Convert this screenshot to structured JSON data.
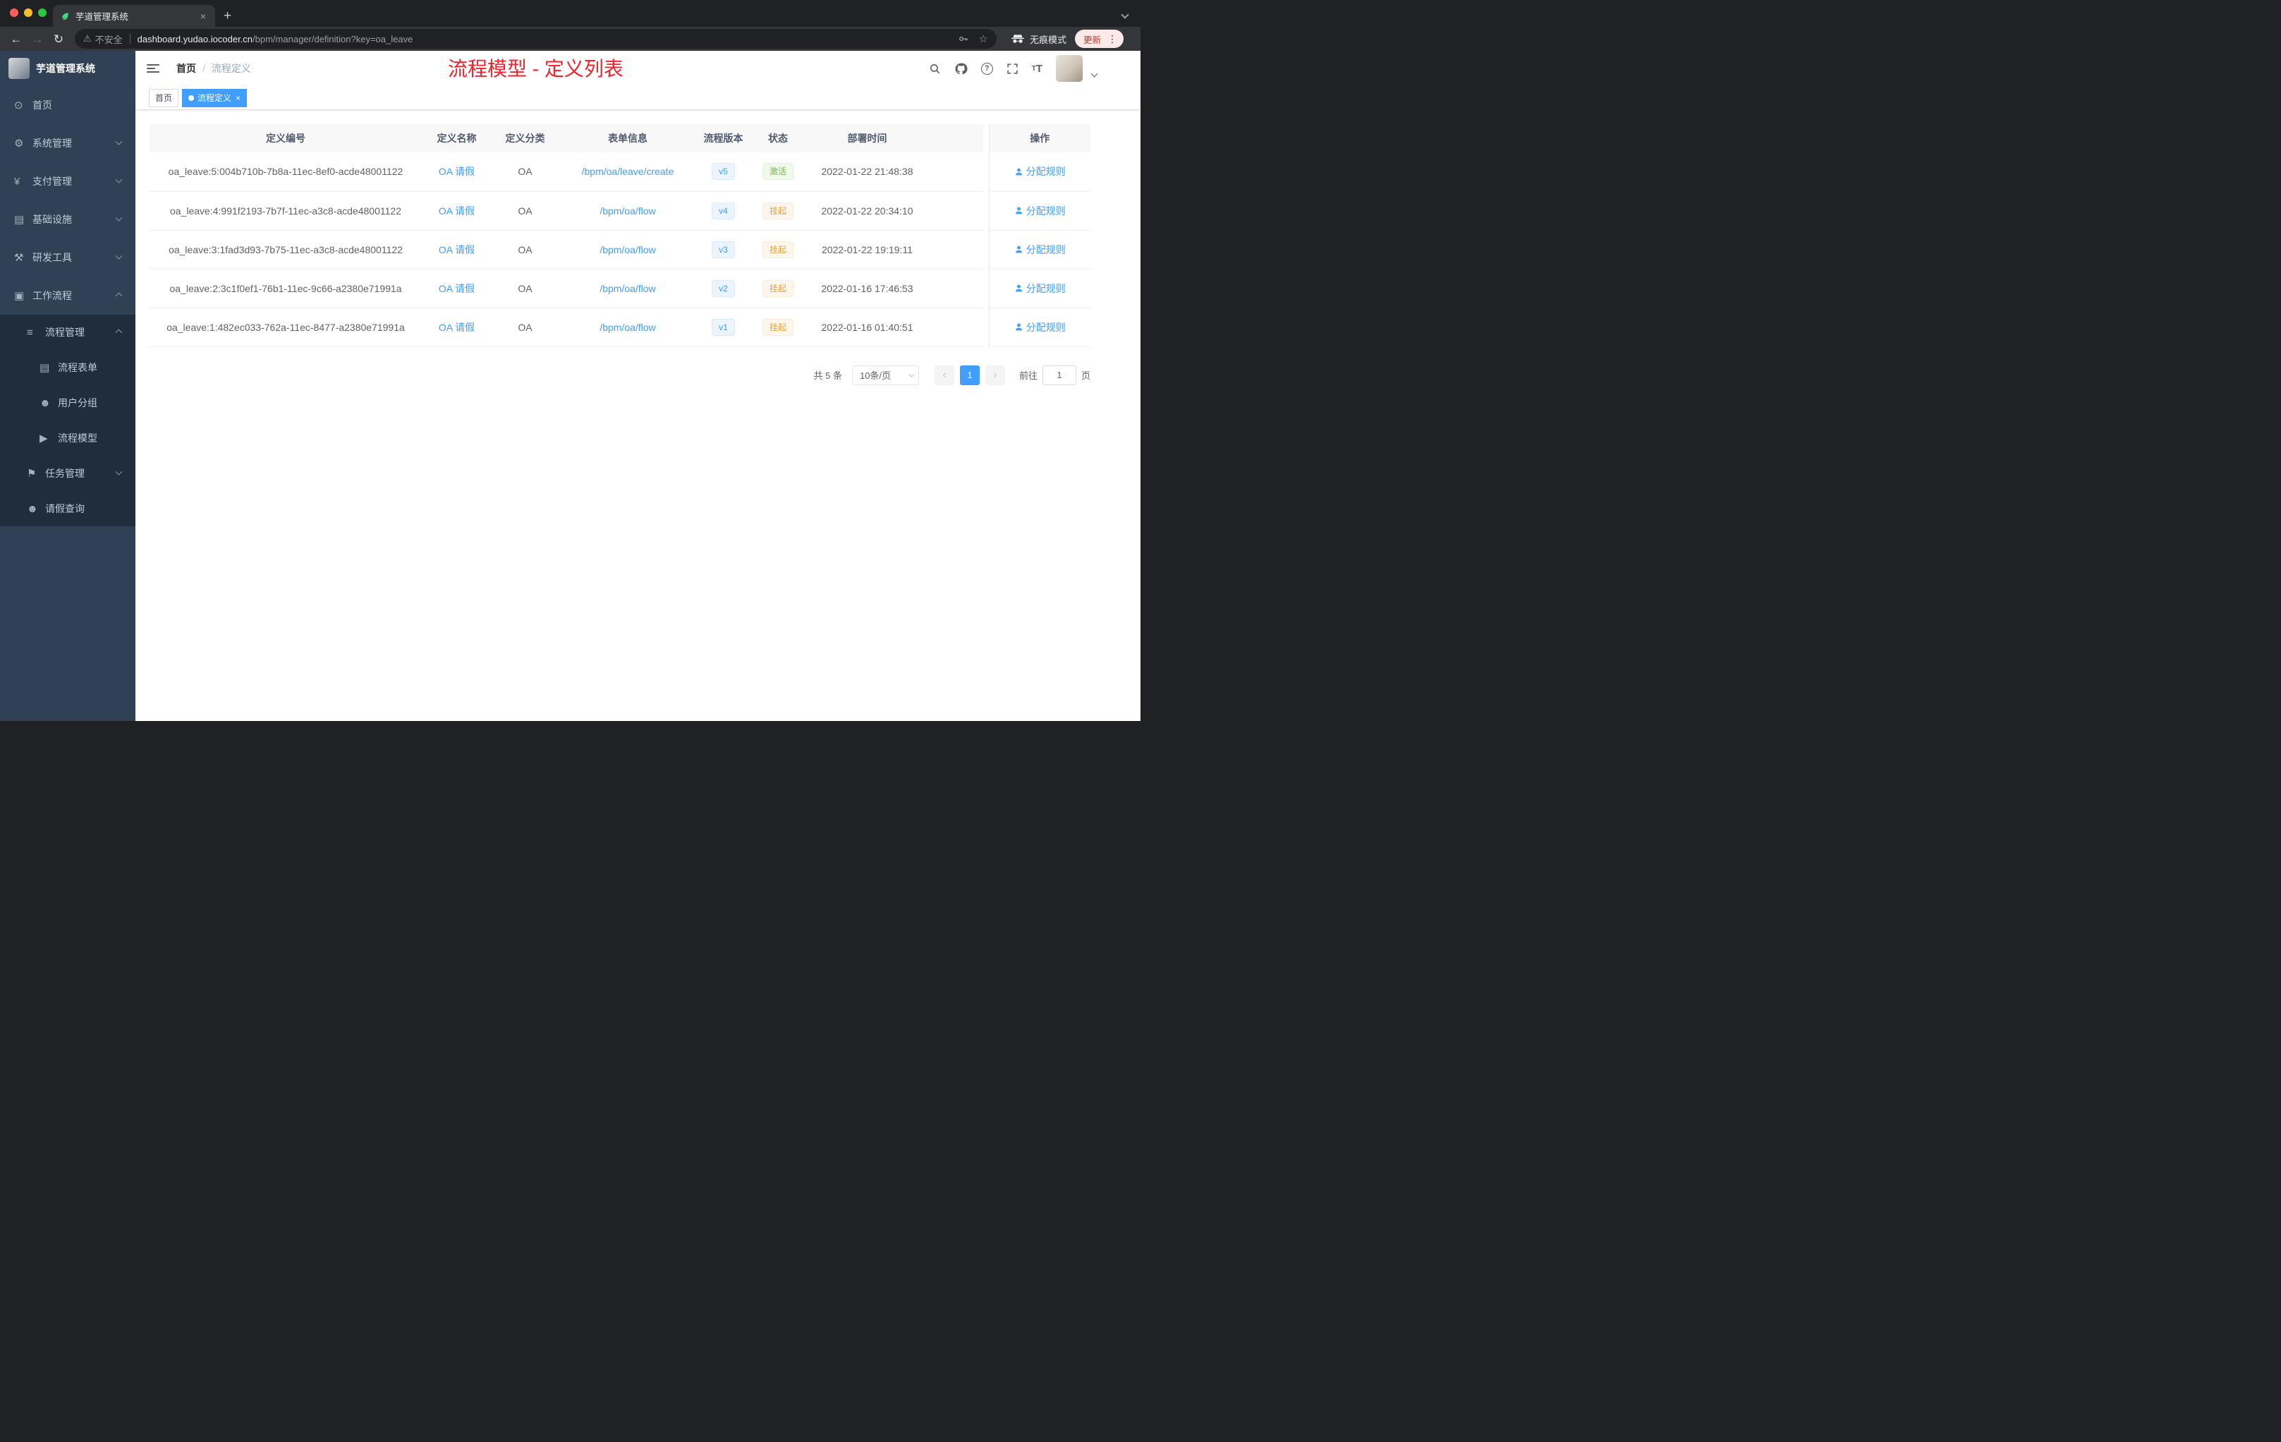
{
  "browser": {
    "tab": {
      "title": "芋道管理系统",
      "close": "×"
    },
    "new_tab": "+",
    "nav": {
      "back": "←",
      "forward": "→",
      "reload": "↻"
    },
    "url": {
      "security_label": "不安全",
      "warning_glyph": "⚠",
      "host": "dashboard.yudao.iocoder.cn",
      "path": "/bpm/manager/definition?key=oa_leave",
      "star_glyph": "☆"
    },
    "incognito_label": "无痕模式",
    "update_label": "更新",
    "menu_dots": "⋮"
  },
  "sidebar": {
    "logo_title": "芋道管理系统",
    "menu": [
      {
        "label": "首页",
        "glyph": "⊙",
        "level": 1,
        "chevron": ""
      },
      {
        "label": "系统管理",
        "glyph": "⚙",
        "level": 1,
        "chevron": "down"
      },
      {
        "label": "支付管理",
        "glyph": "¥",
        "level": 1,
        "chevron": "down"
      },
      {
        "label": "基础设施",
        "glyph": "▤",
        "level": 1,
        "chevron": "down"
      },
      {
        "label": "研发工具",
        "glyph": "⚒",
        "level": 1,
        "chevron": "down"
      },
      {
        "label": "工作流程",
        "glyph": "▣",
        "level": 1,
        "chevron": "up"
      },
      {
        "label": "流程管理",
        "glyph": "≡",
        "level": 2,
        "chevron": "up"
      },
      {
        "label": "流程表单",
        "glyph": "▤",
        "level": 3,
        "chevron": ""
      },
      {
        "label": "用户分组",
        "glyph": "☻",
        "level": 3,
        "chevron": ""
      },
      {
        "label": "流程模型",
        "glyph": "▶",
        "level": 3,
        "chevron": ""
      },
      {
        "label": "任务管理",
        "glyph": "⚑",
        "level": 2,
        "chevron": "down"
      },
      {
        "label": "请假查询",
        "glyph": "☻",
        "level": 2,
        "chevron": ""
      }
    ]
  },
  "header": {
    "breadcrumb": {
      "home": "首页",
      "separator": "/",
      "current": "流程定义"
    },
    "annotation": {
      "text": "流程模型 - 定义列表",
      "color": "#f5222d"
    },
    "font_icon": "T"
  },
  "tags_bar": {
    "tags": [
      {
        "label": "首页",
        "active": false
      },
      {
        "label": "流程定义",
        "active": true
      }
    ],
    "close": "×"
  },
  "table": {
    "columns": [
      "定义编号",
      "定义名称",
      "定义分类",
      "表单信息",
      "流程版本",
      "状态",
      "部署时间",
      "操作"
    ],
    "status_colors": {
      "success": "#67c23a",
      "warning": "#e6a23c"
    },
    "accent_color": "#409eff",
    "rows": [
      {
        "id": "oa_leave:5:004b710b-7b8a-11ec-8ef0-acde48001122",
        "name": "OA 请假",
        "category": "OA",
        "form": "/bpm/oa/leave/create",
        "version": "v5",
        "status": "激活",
        "status_type": "success",
        "deploy_time": "2022-01-22 21:48:38",
        "action": "分配规则"
      },
      {
        "id": "oa_leave:4:991f2193-7b7f-11ec-a3c8-acde48001122",
        "name": "OA 请假",
        "category": "OA",
        "form": "/bpm/oa/flow",
        "version": "v4",
        "status": "挂起",
        "status_type": "warning",
        "deploy_time": "2022-01-22 20:34:10",
        "action": "分配规则"
      },
      {
        "id": "oa_leave:3:1fad3d93-7b75-11ec-a3c8-acde48001122",
        "name": "OA 请假",
        "category": "OA",
        "form": "/bpm/oa/flow",
        "version": "v3",
        "status": "挂起",
        "status_type": "warning",
        "deploy_time": "2022-01-22 19:19:11",
        "action": "分配规则"
      },
      {
        "id": "oa_leave:2:3c1f0ef1-76b1-11ec-9c66-a2380e71991a",
        "name": "OA 请假",
        "category": "OA",
        "form": "/bpm/oa/flow",
        "version": "v2",
        "status": "挂起",
        "status_type": "warning",
        "deploy_time": "2022-01-16 17:46:53",
        "action": "分配规则"
      },
      {
        "id": "oa_leave:1:482ec033-762a-11ec-8477-a2380e71991a",
        "name": "OA 请假",
        "category": "OA",
        "form": "/bpm/oa/flow",
        "version": "v1",
        "status": "挂起",
        "status_type": "warning",
        "deploy_time": "2022-01-16 01:40:51",
        "action": "分配规则"
      }
    ]
  },
  "pagination": {
    "total": "共 5 条",
    "page_size": "10条/页",
    "prev": "‹",
    "next": "›",
    "current_page": "1",
    "goto_label": "前往",
    "goto_value": "1",
    "page_unit": "页"
  }
}
